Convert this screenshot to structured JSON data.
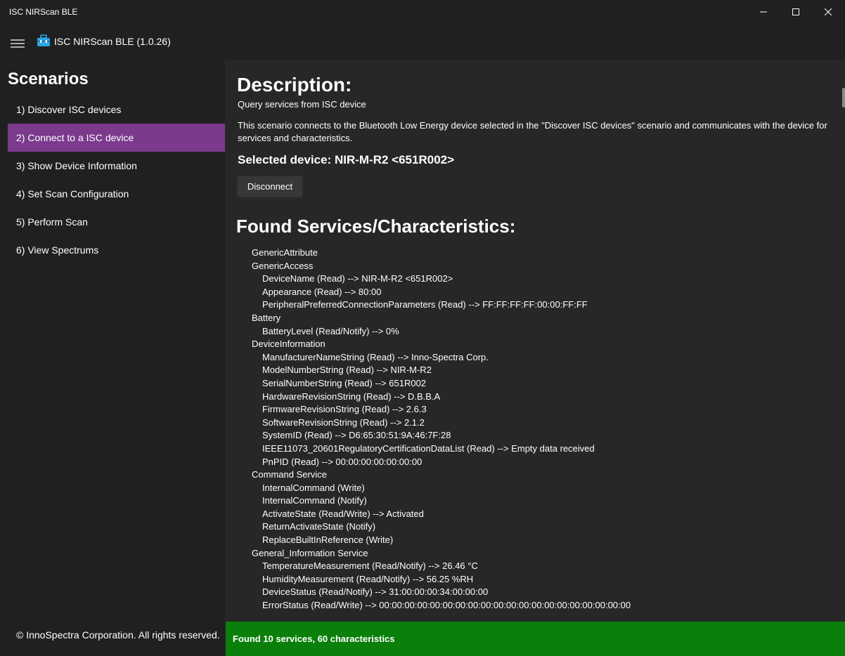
{
  "window": {
    "title": "ISC NIRScan BLE",
    "controls": [
      "minimize-icon",
      "maximize-icon",
      "close-icon"
    ]
  },
  "header": {
    "menu_icon": "hamburger-icon",
    "app_icon": "toolbox-icon",
    "title": "ISC NIRScan BLE (1.0.26)"
  },
  "sidebar": {
    "heading": "Scenarios",
    "items": [
      {
        "label": "1) Discover ISC devices"
      },
      {
        "label": "2) Connect to a ISC device"
      },
      {
        "label": "3) Show Device Information"
      },
      {
        "label": "4) Set Scan Configuration"
      },
      {
        "label": "5) Perform Scan"
      },
      {
        "label": "6) View Spectrums"
      }
    ],
    "selected_index": 1,
    "footer": "© InnoSpectra Corporation. All rights reserved."
  },
  "main": {
    "description_heading": "Description:",
    "description_sub": "Query services from ISC device",
    "description_body": "This scenario connects to the Bluetooth Low Energy device selected in the \"Discover ISC devices\" scenario and communicates with the device for services and characteristics.",
    "selected_device": "Selected device: NIR-M-R2 <651R002>",
    "disconnect_label": "Disconnect",
    "found_heading": "Found Services/Characteristics:",
    "services": [
      {
        "text": "GenericAttribute",
        "child": false
      },
      {
        "text": "GenericAccess",
        "child": false
      },
      {
        "text": "DeviceName (Read)  --> NIR-M-R2 <651R002>",
        "child": true
      },
      {
        "text": "Appearance (Read)  --> 80:00",
        "child": true
      },
      {
        "text": "PeripheralPreferredConnectionParameters (Read)  --> FF:FF:FF:FF:00:00:FF:FF",
        "child": true
      },
      {
        "text": "Battery",
        "child": false
      },
      {
        "text": "BatteryLevel (Read/Notify)  --> 0%",
        "child": true
      },
      {
        "text": "DeviceInformation",
        "child": false
      },
      {
        "text": "ManufacturerNameString (Read)  --> Inno-Spectra Corp.",
        "child": true
      },
      {
        "text": "ModelNumberString (Read)  --> NIR-M-R2",
        "child": true
      },
      {
        "text": "SerialNumberString (Read)  --> 651R002",
        "child": true
      },
      {
        "text": "HardwareRevisionString (Read)  --> D.B.B.A",
        "child": true
      },
      {
        "text": "FirmwareRevisionString (Read)  --> 2.6.3",
        "child": true
      },
      {
        "text": "SoftwareRevisionString (Read)  --> 2.1.2",
        "child": true
      },
      {
        "text": "SystemID (Read)  --> D6:65:30:51:9A:46:7F:28",
        "child": true
      },
      {
        "text": "IEEE11073_20601RegulatoryCertificationDataList (Read)  --> Empty data received",
        "child": true
      },
      {
        "text": "PnPID (Read)  --> 00:00:00:00:00:00:00",
        "child": true
      },
      {
        "text": "Command Service",
        "child": false
      },
      {
        "text": "InternalCommand (Write)",
        "child": true
      },
      {
        "text": "InternalCommand (Notify)",
        "child": true
      },
      {
        "text": "ActivateState (Read/Write)  --> Activated",
        "child": true
      },
      {
        "text": "ReturnActivateState (Notify)",
        "child": true
      },
      {
        "text": "ReplaceBuiltInReference (Write)",
        "child": true
      },
      {
        "text": "General_Information Service",
        "child": false
      },
      {
        "text": "TemperatureMeasurement (Read/Notify)  --> 26.46 °C",
        "child": true
      },
      {
        "text": "HumidityMeasurement (Read/Notify)  --> 56.25 %RH",
        "child": true
      },
      {
        "text": "DeviceStatus (Read/Notify)  --> 31:00:00:00:34:00:00:00",
        "child": true
      },
      {
        "text": "ErrorStatus (Read/Write)  --> 00:00:00:00:00:00:00:00:00:00:00:00:00:00:00:00:00:00:00:00",
        "child": true
      }
    ]
  },
  "status": {
    "text": "Found 10 services, 60 characteristics",
    "color": "#0a7f0a"
  },
  "colors": {
    "accent": "#7b3a8c",
    "background": "#202020",
    "content_background": "#272727"
  }
}
